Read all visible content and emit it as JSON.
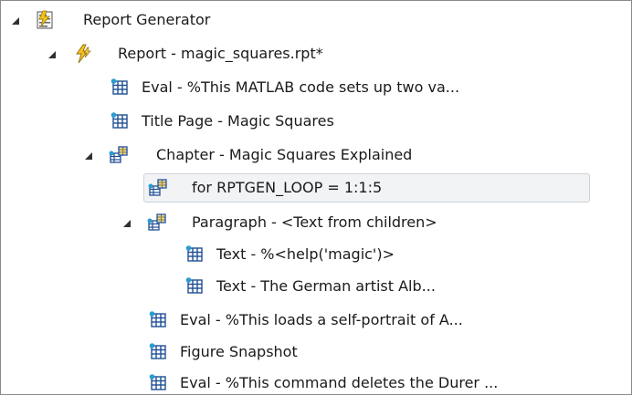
{
  "tree": {
    "root": {
      "label": "Report Generator"
    },
    "report": {
      "label": "Report - magic_squares.rpt*"
    },
    "eval_setup": {
      "label": "Eval - %This MATLAB code sets up two va..."
    },
    "title_page": {
      "label": "Title Page - Magic Squares"
    },
    "chapter": {
      "label": "Chapter - Magic Squares Explained"
    },
    "for_loop": {
      "label": "for RPTGEN_LOOP = 1:1:5"
    },
    "paragraph": {
      "label": "Paragraph - <Text from children>"
    },
    "text_help": {
      "label": "Text - %<help('magic')>"
    },
    "text_german": {
      "label": "Text - The German artist Alb..."
    },
    "eval_portrait": {
      "label": "Eval - %This loads a self-portrait of A..."
    },
    "figure_snapshot": {
      "label": "Figure Snapshot"
    },
    "eval_delete": {
      "label": "Eval - %This command deletes the Durer ..."
    }
  },
  "colors": {
    "selection_bg": "#f2f3f5",
    "selection_border": "#cdd1d7",
    "icon_blue": "#1f4f93",
    "icon_gold": "#e3b21a",
    "icon_teal": "#2b9bd1"
  },
  "icons": {
    "root": "report-generator-icon",
    "report": "lightning-icon",
    "component": "table-grid-icon",
    "container": "component-group-icon"
  }
}
